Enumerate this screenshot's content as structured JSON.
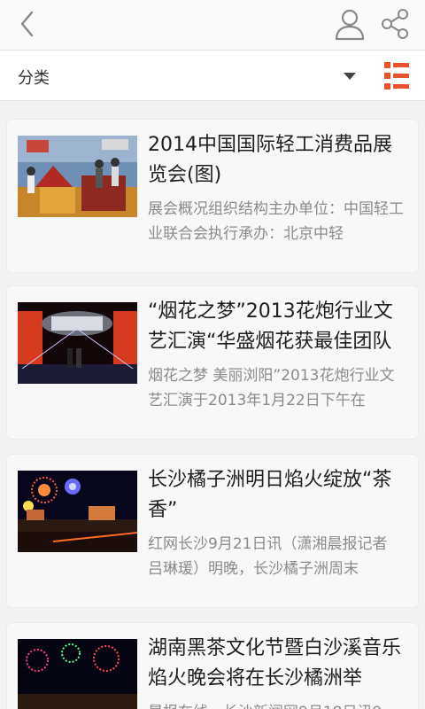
{
  "header": {
    "back_icon": "chevron-left-icon",
    "user_icon": "user-icon",
    "share_icon": "share-icon"
  },
  "filter": {
    "label": "分类",
    "accent_color": "#e8532d"
  },
  "articles": [
    {
      "title": "2014中国国际轻工消费品展览会(图)",
      "summary": "展会概况组织结构主办单位：中国轻工业联合会执行承办：北京中轻"
    },
    {
      "title": "“烟花之梦”2013花炮行业文艺汇演“华盛烟花获最佳团队",
      "summary": "烟花之梦 美丽浏阳”2013花炮行业文艺汇演于2013年1月22日下午在"
    },
    {
      "title": "长沙橘子洲明日焰火绽放“茶香”",
      "summary": "红网长沙9月21日讯（潇湘晨报记者 吕琳瑗）明晚，长沙橘子洲周末"
    },
    {
      "title": "湖南黑茶文化节暨白沙溪音乐焰火晚会将在长沙橘洲举",
      "summary": "晨报在线，长沙新闻网9月18日讯9"
    }
  ]
}
